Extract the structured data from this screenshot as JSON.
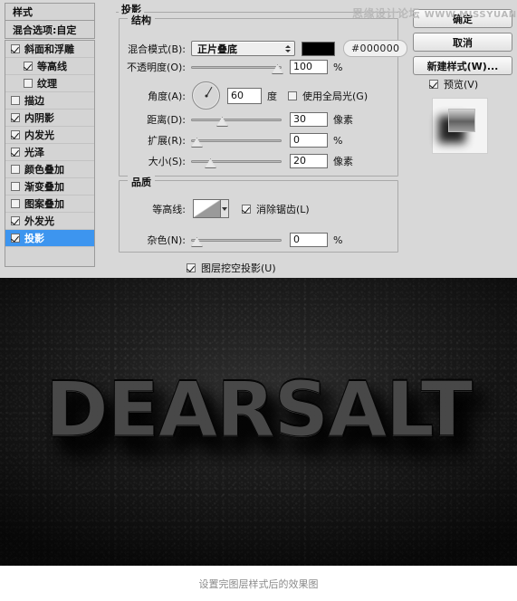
{
  "dialog": {
    "styles_panel": {
      "header": "样式",
      "blending_options": "混合选项:自定",
      "items": [
        {
          "label": "斜面和浮雕",
          "checked": true,
          "indent": false,
          "selected": false
        },
        {
          "label": "等高线",
          "checked": true,
          "indent": true,
          "selected": false
        },
        {
          "label": "纹理",
          "checked": false,
          "indent": true,
          "selected": false
        },
        {
          "label": "描边",
          "checked": false,
          "indent": false,
          "selected": false
        },
        {
          "label": "内阴影",
          "checked": true,
          "indent": false,
          "selected": false
        },
        {
          "label": "内发光",
          "checked": true,
          "indent": false,
          "selected": false
        },
        {
          "label": "光泽",
          "checked": true,
          "indent": false,
          "selected": false
        },
        {
          "label": "颜色叠加",
          "checked": false,
          "indent": false,
          "selected": false
        },
        {
          "label": "渐变叠加",
          "checked": false,
          "indent": false,
          "selected": false
        },
        {
          "label": "图案叠加",
          "checked": false,
          "indent": false,
          "selected": false
        },
        {
          "label": "外发光",
          "checked": true,
          "indent": false,
          "selected": false
        },
        {
          "label": "投影",
          "checked": true,
          "indent": false,
          "selected": true
        }
      ]
    },
    "panel_title": "投影",
    "structure": {
      "title": "结构",
      "blend_mode_label": "混合模式(B):",
      "blend_mode_value": "正片叠底",
      "color_swatch": "#000000",
      "color_hex": "#000000",
      "opacity_label": "不透明度(O):",
      "opacity_value": "100",
      "opacity_unit": "%",
      "angle_label": "角度(A):",
      "angle_value": "60",
      "angle_unit": "度",
      "use_global_light_label": "使用全局光(G)",
      "use_global_light_checked": false,
      "distance_label": "距离(D):",
      "distance_value": "30",
      "distance_unit": "像素",
      "spread_label": "扩展(R):",
      "spread_value": "0",
      "spread_unit": "%",
      "size_label": "大小(S):",
      "size_value": "20",
      "size_unit": "像素"
    },
    "quality": {
      "title": "品质",
      "contour_label": "等高线:",
      "anti_alias_label": "消除锯齿(L)",
      "anti_alias_checked": true,
      "noise_label": "杂色(N):",
      "noise_value": "0",
      "noise_unit": "%"
    },
    "layer_knocks_out": {
      "label": "图层挖空投影(U)",
      "checked": true
    },
    "buttons": {
      "ok": "确定",
      "cancel": "取消",
      "new_style": "新建样式(W)...",
      "preview_label": "预览(V)",
      "preview_checked": true
    }
  },
  "watermark": {
    "cn": "思缘设计论坛",
    "en": "WWW.MISSYUAN.COM"
  },
  "photo": {
    "artwork_text": "DEARSALT"
  },
  "caption": "设置完图层样式后的效果图"
}
